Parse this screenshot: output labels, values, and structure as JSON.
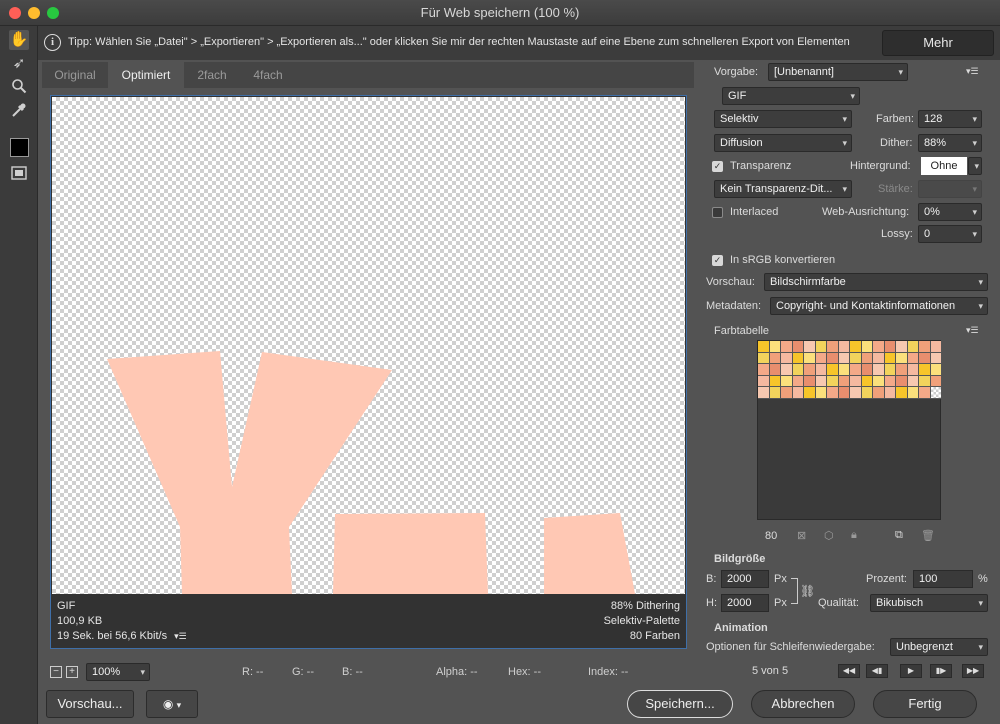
{
  "window": {
    "title": "Für Web speichern (100 %)"
  },
  "tip": {
    "text": "Tipp: Wählen Sie „Datei\" > „Exportieren\" > „Exportieren als...\" oder klicken Sie mir der rechten Maustaste auf eine Ebene zum schnelleren Export von Elementen",
    "more_label": "Mehr"
  },
  "tabs": [
    {
      "label": "Original"
    },
    {
      "label": "Optimiert"
    },
    {
      "label": "2fach"
    },
    {
      "label": "4fach"
    }
  ],
  "preview_info": {
    "format": "GIF",
    "size": "100,9 KB",
    "time": "19 Sek. bei 56,6 Kbit/s",
    "dither": "88% Dithering",
    "palette": "Selektiv-Palette",
    "colors": "80 Farben"
  },
  "status": {
    "zoom": "100%",
    "r": "R: --",
    "g": "G: --",
    "b": "B: --",
    "alpha": "Alpha: --",
    "hex": "Hex: --",
    "index": "Index: --"
  },
  "bottom": {
    "preview_label": "Vorschau...",
    "save_label": "Speichern...",
    "cancel_label": "Abbrechen",
    "done_label": "Fertig"
  },
  "settings": {
    "preset_label": "Vorgabe:",
    "preset_value": "[Unbenannt]",
    "format_value": "GIF",
    "reduction_value": "Selektiv",
    "colors_label": "Farben:",
    "colors_value": "128",
    "dither_algo_value": "Diffusion",
    "dither_label": "Dither:",
    "dither_value": "88%",
    "transparency_label": "Transparenz",
    "matte_label": "Hintergrund:",
    "matte_value": "Ohne",
    "trans_dither_value": "Kein Transparenz-Dit...",
    "amount_label": "Stärke:",
    "interlaced_label": "Interlaced",
    "web_snap_label": "Web-Ausrichtung:",
    "web_snap_value": "0%",
    "lossy_label": "Lossy:",
    "lossy_value": "0",
    "srgb_label": "In sRGB konvertieren",
    "preview_mode_label": "Vorschau:",
    "preview_mode_value": "Bildschirmfarbe",
    "metadata_label": "Metadaten:",
    "metadata_value": "Copyright- und Kontaktinformationen",
    "color_table_label": "Farbtabelle",
    "color_count": "80"
  },
  "image_size": {
    "heading": "Bildgröße",
    "w_label": "B:",
    "w_value": "2000",
    "h_label": "H:",
    "h_value": "2000",
    "unit": "Px",
    "percent_label": "Prozent:",
    "percent_value": "100",
    "percent_unit": "%",
    "quality_label": "Qualität:",
    "quality_value": "Bikubisch"
  },
  "animation": {
    "heading": "Animation",
    "loop_label": "Optionen für Schleifenwiedergabe:",
    "loop_value": "Unbegrenzt",
    "frame_counter": "5 von 5"
  },
  "colors": {
    "accent_frame": "#3f6fa8",
    "shape_fill": "#ffc8b4",
    "palette": [
      "#f7c52a",
      "#f5b9a0",
      "#f0a07a",
      "#f2d35c",
      "#f7c8b0",
      "#e88e6e",
      "#f4a988",
      "#fbe07c"
    ]
  }
}
